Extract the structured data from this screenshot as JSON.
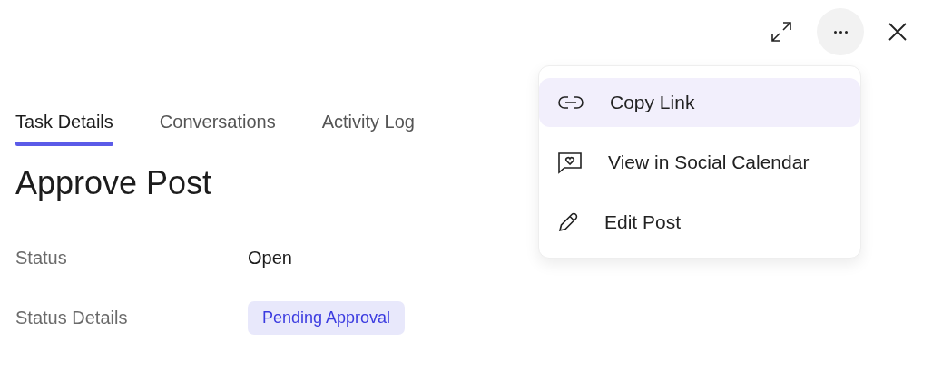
{
  "toolbar": {
    "more_active": true
  },
  "tabs": [
    {
      "label": "Task Details",
      "selected": true
    },
    {
      "label": "Conversations",
      "selected": false
    },
    {
      "label": "Activity Log",
      "selected": false
    }
  ],
  "title": "Approve Post",
  "details": [
    {
      "label": "Status",
      "kind": "text",
      "value": "Open"
    },
    {
      "label": "Status Details",
      "kind": "badge",
      "value": "Pending Approval"
    }
  ],
  "menu": [
    {
      "label": "Copy Link",
      "kind": "link",
      "selected": true
    },
    {
      "label": "View in Social Calendar",
      "kind": "calendar",
      "selected": false
    },
    {
      "label": "Edit Post",
      "kind": "edit",
      "selected": false
    }
  ]
}
